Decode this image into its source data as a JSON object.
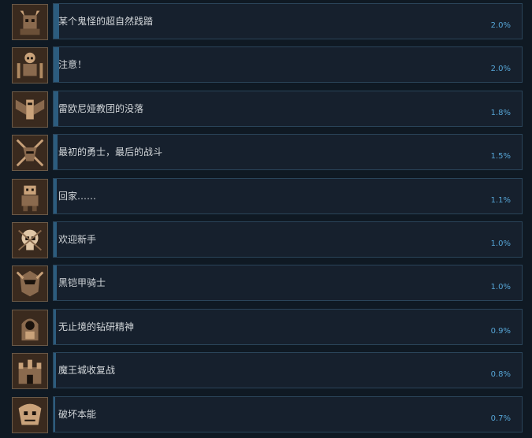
{
  "achievements": [
    {
      "name": "某个鬼怪的超自然践踏",
      "percent": "2.0%",
      "percent_value": 2.0,
      "icon": "horned-demon-icon"
    },
    {
      "name": "注意！",
      "percent": "2.0%",
      "percent_value": 2.0,
      "icon": "skeleton-warrior-icon"
    },
    {
      "name": "雷欧尼娅教团的没落",
      "percent": "1.8%",
      "percent_value": 1.8,
      "icon": "winged-knight-icon"
    },
    {
      "name": "最初的勇士，最后的战斗",
      "percent": "1.5%",
      "percent_value": 1.5,
      "icon": "crossed-swords-helmet-icon"
    },
    {
      "name": "回家……",
      "percent": "1.1%",
      "percent_value": 1.1,
      "icon": "robot-figure-icon"
    },
    {
      "name": "欢迎新手",
      "percent": "1.0%",
      "percent_value": 1.0,
      "icon": "skull-icon"
    },
    {
      "name": "黑铠甲骑士",
      "percent": "1.0%",
      "percent_value": 1.0,
      "icon": "armored-helmet-icon"
    },
    {
      "name": "无止境的钻研精神",
      "percent": "0.9%",
      "percent_value": 0.9,
      "icon": "hooded-figure-icon"
    },
    {
      "name": "魔王城收复战",
      "percent": "0.8%",
      "percent_value": 0.8,
      "icon": "castle-icon"
    },
    {
      "name": "破坏本能",
      "percent": "0.7%",
      "percent_value": 0.7,
      "icon": "beast-skull-icon"
    }
  ],
  "colors": {
    "background": "#0f1923",
    "bar_fill": "#2c5c7e",
    "percent_text": "#56a5d6",
    "name_text": "#d3d7da"
  }
}
